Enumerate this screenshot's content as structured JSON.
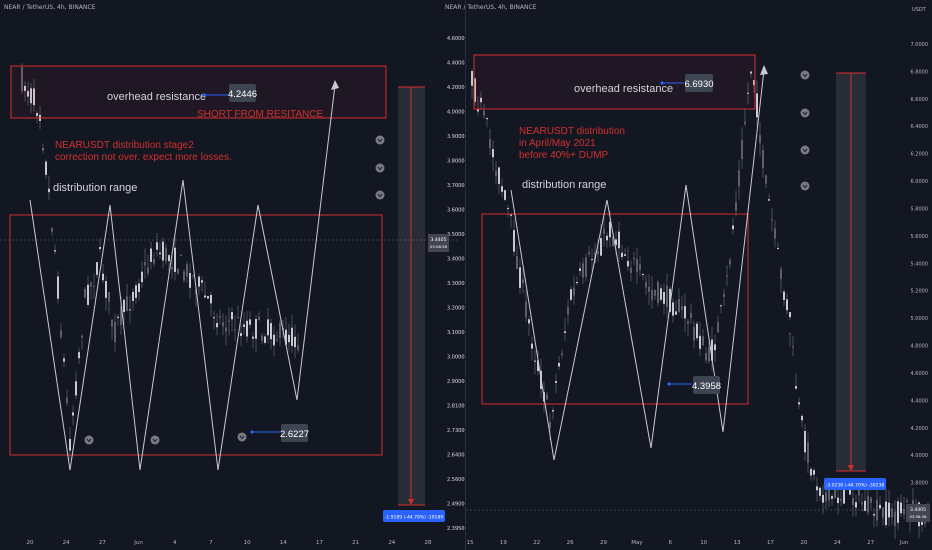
{
  "chart_data": [
    {
      "type": "candlestick",
      "title": "NEAR / TetherUS, 4h, BINANCE",
      "y_ticks": [
        "2.3950",
        "2.4900",
        "2.5600",
        "2.6400",
        "2.7300",
        "2.8100",
        "2.9000",
        "3.0000",
        "3.1000",
        "3.2000",
        "3.3000",
        "3.4000",
        "3.5000",
        "3.6000",
        "3.7000",
        "3.8000",
        "3.9000",
        "4.0000",
        "4.2000",
        "4.4000",
        "4.6000"
      ],
      "x_ticks": [
        "20",
        "24",
        "27",
        "Jun",
        "4",
        "7",
        "10",
        "14",
        "17",
        "21",
        "24",
        "28"
      ],
      "current_price": "3.4405",
      "current_time": "03:08:58",
      "resistance_box_label": "overhead resistance",
      "resistance_price_badge": "4.2446",
      "short_note": "SHORT FROM RESITANCE",
      "notes": [
        "NEARUSDT distribution stage2",
        "correction not over. expect more losses."
      ],
      "range_label": "distribution range",
      "range_price_badge": "2.6227",
      "measure_label": "-1.9189 (-44.79%) -19189"
    },
    {
      "type": "candlestick",
      "title": "NEAR / TetherUS, 4h, BINANCE",
      "y_unit": "USDT",
      "y_ticks": [
        "3.6000",
        "3.8000",
        "4.0000",
        "4.2000",
        "4.4000",
        "4.6000",
        "4.8000",
        "5.0000",
        "5.2000",
        "5.4000",
        "5.6000",
        "5.8000",
        "6.0000",
        "6.2000",
        "6.4000",
        "6.6000",
        "6.8000",
        "7.0000"
      ],
      "left_y_ticks": [
        "2.3950",
        "2.4900",
        "2.5600",
        "2.6400",
        "2.7300",
        "2.8100",
        "2.9000",
        "3.0000",
        "3.1000",
        "3.2000",
        "3.3000",
        "3.4000",
        "3.5000",
        "3.6000",
        "3.7000",
        "3.8000",
        "3.9000",
        "4.0000",
        "4.2000",
        "4.4000",
        "4.6000"
      ],
      "x_ticks": [
        "15",
        "19",
        "22",
        "26",
        "29",
        "May",
        "6",
        "10",
        "13",
        "17",
        "20",
        "24",
        "27",
        "Jun"
      ],
      "current_price": "3.4405",
      "current_time": "03:08:58",
      "resistance_box_label": "overhead resistance",
      "resistance_price_badge": "6.6930",
      "notes": [
        "NEARUSDT distribution",
        "in April/May 2021",
        "before 40%+ DUMP"
      ],
      "range_label": "distribution range",
      "range_price_badge": "4.3958",
      "measure_label": "-3.0238 (-44.70%) -30238"
    }
  ]
}
